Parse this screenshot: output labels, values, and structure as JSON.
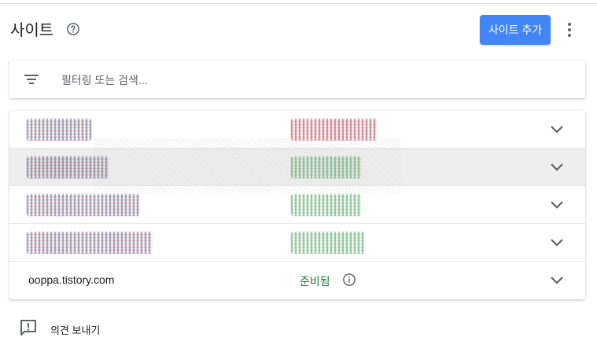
{
  "header": {
    "title": "사이트",
    "help_icon": "help-circle-icon",
    "add_site_label": "사이트 추가",
    "more_icon": "more-vert-icon",
    "accent_color": "#4285f4"
  },
  "filter": {
    "icon": "filter-list-icon",
    "placeholder": "필터링 또는 검색..."
  },
  "sites": [
    {
      "name": "",
      "status": "",
      "redacted": true,
      "status_color": "red"
    },
    {
      "name": "",
      "status": "",
      "redacted": true,
      "status_color": "green"
    },
    {
      "name": "",
      "status": "",
      "redacted": true,
      "status_color": "green"
    },
    {
      "name": "",
      "status": "",
      "redacted": true,
      "status_color": "green"
    },
    {
      "name": "ooppa.tistory.com",
      "status": "준비됨",
      "redacted": false,
      "status_color": "#188038"
    }
  ],
  "footer": {
    "feedback_icon": "feedback-icon",
    "feedback_label": "의견 보내기"
  }
}
